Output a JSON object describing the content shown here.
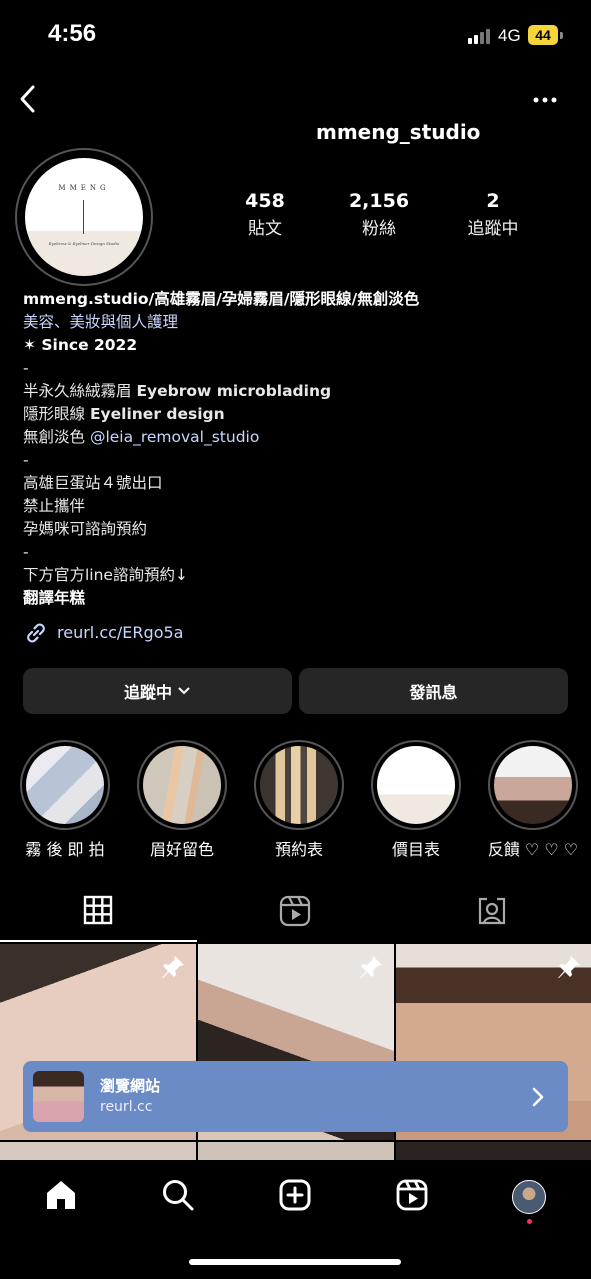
{
  "status": {
    "time": "4:56",
    "network": "4G",
    "battery": "44"
  },
  "header": {
    "username": "mmeng_studio"
  },
  "avatar": {
    "brand": "MMENG",
    "subtitle": "Eyebrow & Eyeliner Design Studio"
  },
  "stats": [
    {
      "value": "458",
      "label": "貼文"
    },
    {
      "value": "2,156",
      "label": "粉絲"
    },
    {
      "value": "2",
      "label": "追蹤中"
    }
  ],
  "bio": {
    "name": "mmeng.studio/高雄霧眉/孕婦霧眉/隱形眼線/無創淡色",
    "category": "美容、美妝與個人護理",
    "since": "✶ Since 2022",
    "dash1": "-",
    "line1_cn": "半永久絲絨霧眉 ",
    "line1_en": "Eyebrow microblading",
    "line2_cn": "隱形眼線 ",
    "line2_en": "Eyeliner design",
    "line3_cn": "無創淡色 ",
    "line3_mention": "@leia_removal_studio",
    "dash2": "-",
    "line4": "高雄巨蛋站４號出口",
    "line5": "禁止攜伴",
    "line6": "孕媽咪可諮詢預約",
    "dash3": "-",
    "line7": "下方官方line諮詢預約↓",
    "translate": "翻譯年糕",
    "link": "reurl.cc/ERgo5a"
  },
  "actions": {
    "follow": "追蹤中",
    "message": "發訊息"
  },
  "highlights": [
    {
      "label": "霧 後 即 拍"
    },
    {
      "label": "眉好留色"
    },
    {
      "label": "預約表"
    },
    {
      "label": "價目表"
    },
    {
      "label": "反饋 ♡ ♡ ♡"
    }
  ],
  "banner": {
    "title": "瀏覽網站",
    "url": "reurl.cc"
  },
  "colors": {
    "background": "#000000",
    "button": "#262626",
    "banner": "#6a8bc6",
    "link": "#c7d6ff"
  }
}
